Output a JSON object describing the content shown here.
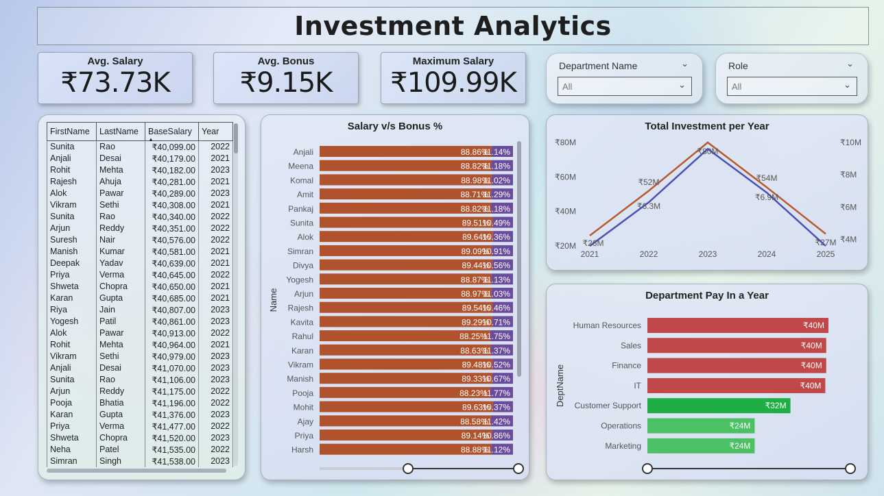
{
  "title": "Investment Analytics",
  "cards": [
    {
      "label": "Avg. Salary",
      "value": "₹73.73K"
    },
    {
      "label": "Avg. Bonus",
      "value": "₹9.15K"
    },
    {
      "label": "Maximum Salary",
      "value": "₹109.99K"
    }
  ],
  "slicers": {
    "department": {
      "title": "Department Name",
      "value": "All"
    },
    "role": {
      "title": "Role",
      "value": "All"
    }
  },
  "table": {
    "columns": [
      "FirstName",
      "LastName",
      "BaseSalary",
      "Year"
    ],
    "rows": [
      [
        "Sunita",
        "Rao",
        "₹40,099.00",
        "2022"
      ],
      [
        "Anjali",
        "Desai",
        "₹40,179.00",
        "2021"
      ],
      [
        "Rohit",
        "Mehta",
        "₹40,182.00",
        "2023"
      ],
      [
        "Rajesh",
        "Ahuja",
        "₹40,281.00",
        "2021"
      ],
      [
        "Alok",
        "Pawar",
        "₹40,289.00",
        "2023"
      ],
      [
        "Vikram",
        "Sethi",
        "₹40,308.00",
        "2021"
      ],
      [
        "Sunita",
        "Rao",
        "₹40,340.00",
        "2022"
      ],
      [
        "Arjun",
        "Reddy",
        "₹40,351.00",
        "2022"
      ],
      [
        "Suresh",
        "Nair",
        "₹40,576.00",
        "2022"
      ],
      [
        "Manish",
        "Kumar",
        "₹40,581.00",
        "2021"
      ],
      [
        "Deepak",
        "Yadav",
        "₹40,639.00",
        "2021"
      ],
      [
        "Priya",
        "Verma",
        "₹40,645.00",
        "2022"
      ],
      [
        "Shweta",
        "Chopra",
        "₹40,650.00",
        "2021"
      ],
      [
        "Karan",
        "Gupta",
        "₹40,685.00",
        "2021"
      ],
      [
        "Riya",
        "Jain",
        "₹40,807.00",
        "2023"
      ],
      [
        "Yogesh",
        "Patil",
        "₹40,861.00",
        "2023"
      ],
      [
        "Alok",
        "Pawar",
        "₹40,913.00",
        "2022"
      ],
      [
        "Rohit",
        "Mehta",
        "₹40,964.00",
        "2021"
      ],
      [
        "Vikram",
        "Sethi",
        "₹40,979.00",
        "2023"
      ],
      [
        "Anjali",
        "Desai",
        "₹41,070.00",
        "2023"
      ],
      [
        "Sunita",
        "Rao",
        "₹41,106.00",
        "2023"
      ],
      [
        "Arjun",
        "Reddy",
        "₹41,175.00",
        "2022"
      ],
      [
        "Pooja",
        "Bhatia",
        "₹41,196.00",
        "2022"
      ],
      [
        "Karan",
        "Gupta",
        "₹41,376.00",
        "2023"
      ],
      [
        "Priya",
        "Verma",
        "₹41,477.00",
        "2022"
      ],
      [
        "Shweta",
        "Chopra",
        "₹41,520.00",
        "2023"
      ],
      [
        "Neha",
        "Patel",
        "₹41,535.00",
        "2022"
      ],
      [
        "Simran",
        "Singh",
        "₹41,538.00",
        "2023"
      ]
    ]
  },
  "chart_data": [
    {
      "type": "bar",
      "title": "Salary v/s Bonus %",
      "ylabel": "Name",
      "stacked": "100%",
      "categories": [
        "Anjali",
        "Meena",
        "Komal",
        "Amit",
        "Pankaj",
        "Sunita",
        "Alok",
        "Simran",
        "Divya",
        "Yogesh",
        "Arjun",
        "Rajesh",
        "Kavita",
        "Rahul",
        "Karan",
        "Vikram",
        "Manish",
        "Pooja",
        "Mohit",
        "Ajay",
        "Priya",
        "Harsh"
      ],
      "series": [
        {
          "values": [
            88.86,
            88.82,
            88.98,
            88.71,
            88.82,
            89.51,
            89.64,
            89.09,
            89.44,
            88.87,
            88.97,
            89.54,
            89.29,
            88.25,
            88.63,
            89.48,
            89.33,
            88.23,
            89.63,
            88.58,
            89.14,
            88.88
          ],
          "color": "#b0532c"
        },
        {
          "values": [
            11.14,
            11.18,
            11.02,
            11.29,
            11.18,
            10.49,
            10.36,
            10.91,
            10.56,
            11.13,
            11.03,
            10.46,
            10.71,
            11.75,
            11.37,
            10.52,
            10.67,
            11.77,
            10.37,
            11.42,
            10.86,
            11.12
          ],
          "color": "#6a4c9c"
        }
      ],
      "value_labels": [
        [
          "88.86%",
          "11.14%"
        ],
        [
          "88.82%",
          "11.18%"
        ],
        [
          "88.98%",
          "11.02%"
        ],
        [
          "88.71%",
          "11.29%"
        ],
        [
          "88.82%",
          "11.18%"
        ],
        [
          "89.51%",
          "10.49%"
        ],
        [
          "89.64%",
          "10.36%"
        ],
        [
          "89.09%",
          "10.91%"
        ],
        [
          "89.44%",
          "10.56%"
        ],
        [
          "88.87%",
          "11.13%"
        ],
        [
          "88.97%",
          "11.03%"
        ],
        [
          "89.54%",
          "10.46%"
        ],
        [
          "89.29%",
          "10.71%"
        ],
        [
          "88.25%",
          "11.75%"
        ],
        [
          "88.63%",
          "11.37%"
        ],
        [
          "89.48%",
          "10.52%"
        ],
        [
          "89.33%",
          "10.67%"
        ],
        [
          "88.23%",
          "11.77%"
        ],
        [
          "89.63%",
          "10.37%"
        ],
        [
          "88.58%",
          "11.42%"
        ],
        [
          "89.14%",
          "10.86%"
        ],
        [
          "88.88%",
          "11.12%"
        ]
      ]
    },
    {
      "type": "line",
      "title": "Total Investment per Year",
      "x": [
        "2021",
        "2022",
        "2023",
        "2024",
        "2025"
      ],
      "y_left_ticks": [
        "₹20M",
        "₹40M",
        "₹60M",
        "₹80M"
      ],
      "y_left_range": [
        20,
        80
      ],
      "y_right_ticks": [
        "₹4M",
        "₹6M",
        "₹8M",
        "₹10M"
      ],
      "y_right_range": [
        3.6,
        10
      ],
      "series": [
        {
          "axis": "left",
          "values": [
            26,
            52,
            80,
            54,
            27
          ],
          "labels": [
            "₹26M",
            "₹52M",
            "₹80M",
            "₹54M",
            "₹27M"
          ],
          "color": "#b55a2d"
        },
        {
          "axis": "right",
          "values": [
            3.6,
            6.3,
            9.6,
            6.9,
            3.6
          ],
          "labels": [
            "",
            "₹6.3M",
            "",
            "₹6.9M",
            ""
          ],
          "color": "#4a4fb8"
        }
      ]
    },
    {
      "type": "bar",
      "orientation": "horizontal",
      "title": "Department Pay In a Year",
      "ylabel": "DeptName",
      "categories": [
        "Human Resources",
        "Sales",
        "Finance",
        "IT",
        "Customer Support",
        "Operations",
        "Marketing"
      ],
      "values": [
        40.5,
        40.0,
        40.0,
        39.8,
        32,
        24,
        24
      ],
      "labels": [
        "₹40M",
        "₹40M",
        "₹40M",
        "₹40M",
        "₹32M",
        "₹24M",
        "₹24M"
      ],
      "colors": [
        "#c04848",
        "#c04848",
        "#c04848",
        "#c04848",
        "#1fae44",
        "#4cc064",
        "#4cc064"
      ],
      "xlim": [
        0,
        40.5
      ]
    }
  ]
}
